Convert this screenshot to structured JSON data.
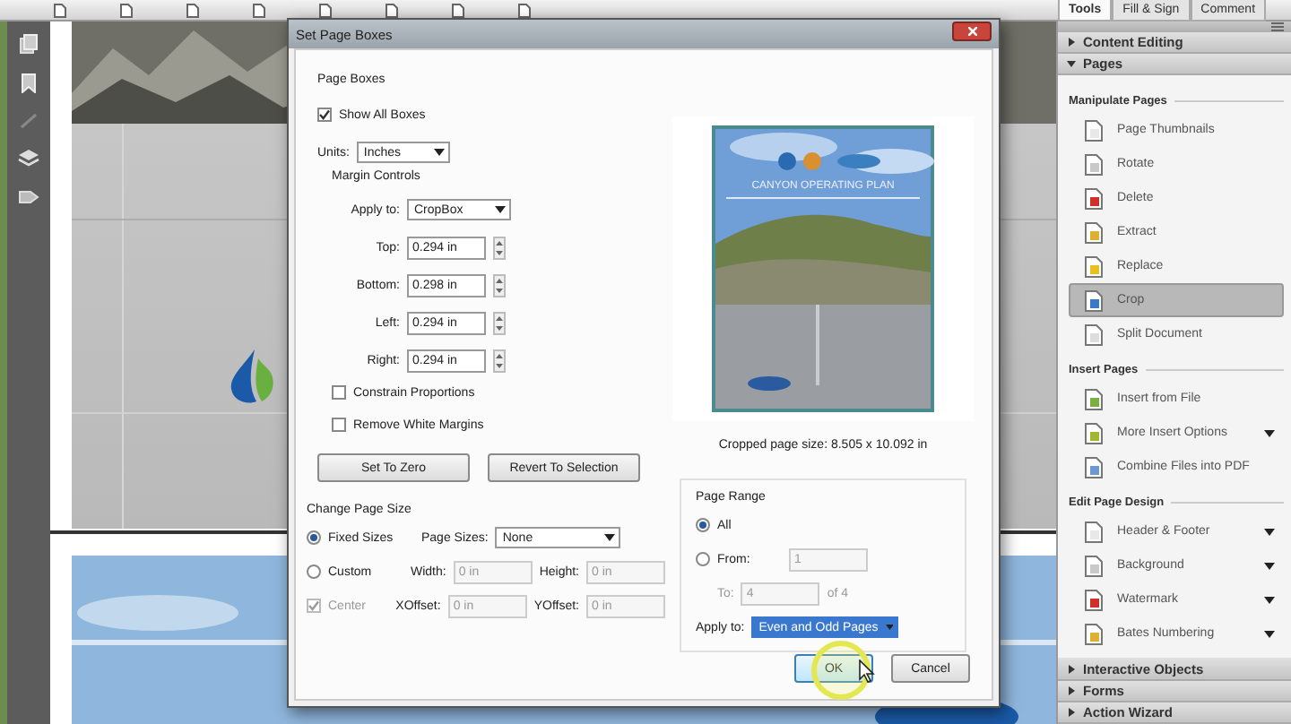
{
  "toolbar": {
    "tabs": [
      {
        "label": "Tools",
        "selected": true
      },
      {
        "label": "Fill & Sign",
        "selected": false
      },
      {
        "label": "Comment",
        "selected": false
      }
    ]
  },
  "dialog": {
    "title": "Set Page Boxes",
    "page_boxes": {
      "title": "Page Boxes",
      "show_all_boxes": {
        "label": "Show All Boxes",
        "checked": true
      },
      "units": {
        "label": "Units:",
        "value": "Inches"
      },
      "margin_controls": {
        "title": "Margin Controls",
        "apply_to": {
          "label": "Apply to:",
          "value": "CropBox"
        },
        "margins": [
          {
            "label": "Top:",
            "value": "0.294 in"
          },
          {
            "label": "Bottom:",
            "value": "0.298 in"
          },
          {
            "label": "Left:",
            "value": "0.294 in"
          },
          {
            "label": "Right:",
            "value": "0.294 in"
          }
        ],
        "options": [
          {
            "label": "Constrain Proportions",
            "checked": false
          },
          {
            "label": "Remove White Margins",
            "checked": false
          }
        ],
        "buttons": [
          "Set To Zero",
          "Revert To Selection"
        ]
      }
    },
    "preview": {
      "cover_title": "CANYON OPERATING PLAN",
      "caption": "Cropped page size: 8.505 x 10.092 in"
    },
    "change_page_size": {
      "title": "Change Page Size",
      "modes": [
        {
          "label": "Fixed Sizes",
          "selected": true
        },
        {
          "label": "Custom",
          "selected": false
        }
      ],
      "page_sizes": {
        "label": "Page Sizes:",
        "value": "None"
      },
      "width": {
        "label": "Width:",
        "value": "0 in",
        "disabled": true
      },
      "height": {
        "label": "Height:",
        "value": "0 in",
        "disabled": true
      },
      "center": {
        "label": "Center",
        "checked": true,
        "disabled": true
      },
      "xoffset": {
        "label": "XOffset:",
        "value": "0 in",
        "disabled": true
      },
      "yoffset": {
        "label": "YOffset:",
        "value": "0 in",
        "disabled": true
      }
    },
    "page_range": {
      "title": "Page Range",
      "options": [
        {
          "label": "All",
          "selected": true
        },
        {
          "label": "From:",
          "selected": false
        }
      ],
      "from": {
        "value": "1",
        "disabled": true
      },
      "to": {
        "label": "To:",
        "value": "4",
        "of": "of 4",
        "disabled": true
      },
      "apply_to": {
        "label": "Apply to:",
        "value": "Even and Odd Pages"
      }
    },
    "buttons": [
      {
        "label": "OK",
        "default": true
      },
      {
        "label": "Cancel",
        "default": false
      }
    ]
  },
  "tools_panel": {
    "sections": [
      {
        "title": "Content Editing",
        "expanded": false
      },
      {
        "title": "Pages",
        "expanded": true,
        "groups": [
          {
            "title": "Manipulate Pages",
            "items": [
              {
                "label": "Page Thumbnails",
                "selected": false,
                "has_menu": false
              },
              {
                "label": "Rotate",
                "selected": false,
                "has_menu": false
              },
              {
                "label": "Delete",
                "selected": false,
                "has_menu": false
              },
              {
                "label": "Extract",
                "selected": false,
                "has_menu": false
              },
              {
                "label": "Replace",
                "selected": false,
                "has_menu": false
              },
              {
                "label": "Crop",
                "selected": true,
                "has_menu": false
              },
              {
                "label": "Split Document",
                "selected": false,
                "has_menu": false
              }
            ]
          },
          {
            "title": "Insert Pages",
            "items": [
              {
                "label": "Insert from File",
                "selected": false,
                "has_menu": false
              },
              {
                "label": "More Insert Options",
                "selected": false,
                "has_menu": true
              },
              {
                "label": "Combine Files into PDF",
                "selected": false,
                "has_menu": false
              }
            ]
          },
          {
            "title": "Edit Page Design",
            "items": [
              {
                "label": "Header & Footer",
                "selected": false,
                "has_menu": true
              },
              {
                "label": "Background",
                "selected": false,
                "has_menu": true
              },
              {
                "label": "Watermark",
                "selected": false,
                "has_menu": true
              },
              {
                "label": "Bates Numbering",
                "selected": false,
                "has_menu": true
              }
            ]
          }
        ]
      },
      {
        "title": "Interactive Objects",
        "expanded": false
      },
      {
        "title": "Forms",
        "expanded": false
      },
      {
        "title": "Action Wizard",
        "expanded": false
      }
    ]
  }
}
